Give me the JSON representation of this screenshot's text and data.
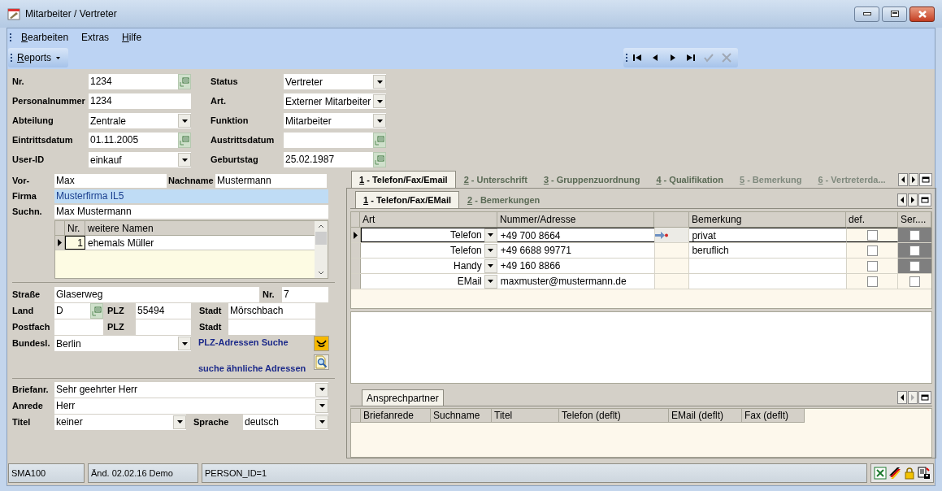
{
  "window": {
    "title": "Mitarbeiter / Vertreter"
  },
  "menu": [
    {
      "label": "Bearbeiten",
      "underline_first": true
    },
    {
      "label": "Extras",
      "underline_first": false
    },
    {
      "label": "Hilfe",
      "underline_first": true
    }
  ],
  "toolbar": {
    "reports": {
      "label": "Reports",
      "underline_first": true
    },
    "nav": [
      {
        "kind": "first",
        "disabled": false
      },
      {
        "kind": "prev",
        "disabled": false
      },
      {
        "kind": "next",
        "disabled": false
      },
      {
        "kind": "last",
        "disabled": false
      },
      {
        "kind": "confirm",
        "disabled": true
      },
      {
        "kind": "cancel",
        "disabled": true
      }
    ]
  },
  "main_form": {
    "left": [
      {
        "label": "Nr.",
        "value": "1234",
        "kind": "lookup"
      },
      {
        "label": "Personalnummer",
        "value": "1234",
        "kind": "text"
      },
      {
        "label": "Abteilung",
        "value": "Zentrale",
        "kind": "dropdown"
      },
      {
        "label": "Eintrittsdatum",
        "value": "01.11.2005",
        "kind": "lookup"
      },
      {
        "label": "User-ID",
        "value": "einkauf",
        "kind": "dropdown"
      }
    ],
    "right": [
      {
        "label": "Status",
        "value": "Vertreter",
        "kind": "dropdown"
      },
      {
        "label": "Art.",
        "value": "Externer Mitarbeiter",
        "kind": "dropdown"
      },
      {
        "label": "Funktion",
        "value": "Mitarbeiter",
        "kind": "dropdown"
      },
      {
        "label": "Austrittsdatum",
        "kind": "lookup"
      },
      {
        "label": "Geburtstag",
        "value": "25.02.1987",
        "kind": "lookup"
      }
    ]
  },
  "name": {
    "first": {
      "label": "Vor-",
      "value": "Max",
      "focused": false
    },
    "last": {
      "label": "Nachname",
      "value": "Mustermann",
      "focused": false
    },
    "company": {
      "label": "Firma",
      "value": "Musterfirma IL5",
      "focused": true
    },
    "search_name": {
      "label": "Suchn.",
      "value": "Max Mustermann",
      "focused": false
    }
  },
  "other_names": {
    "columns": [
      "Nr.",
      "weitere Namen"
    ],
    "rows": [
      {
        "nr": "1",
        "name": "ehemals Müller",
        "current": true
      }
    ]
  },
  "address": {
    "street": {
      "label": "Straße",
      "value": "Glaserweg"
    },
    "house_no": {
      "label": "Nr.",
      "value": "7"
    },
    "country": {
      "label": "Land",
      "value": "D"
    },
    "zip": {
      "label": "PLZ",
      "value": "55494"
    },
    "city": {
      "label": "Stadt",
      "value": "Mörschbach"
    },
    "po_box": {
      "label": "Postfach"
    },
    "po_zip": {
      "label": "PLZ"
    },
    "po_city": {
      "label": "Stadt"
    },
    "state": {
      "label": "Bundesl.",
      "value": "Berlin"
    }
  },
  "links": [
    {
      "label": "PLZ-Adressen Suche",
      "kind": "post"
    },
    {
      "label": "suche ähnliche Adressen",
      "kind": "search"
    }
  ],
  "salutation": {
    "letter": {
      "label": "Briefanr.",
      "value": "Sehr geehrter Herr"
    },
    "address": {
      "label": "Anrede",
      "value": "Herr"
    },
    "title": {
      "label": "Titel",
      "value": "keiner"
    },
    "language": {
      "label": "Sprache",
      "value": "deutsch"
    }
  },
  "tabs": [
    {
      "label": "1 - Telefon/Fax/Email",
      "selected": true,
      "disabled": false
    },
    {
      "label": "2 - Unterschrift",
      "selected": false,
      "disabled": false
    },
    {
      "label": "3 - Gruppenzuordnung",
      "selected": false,
      "disabled": false
    },
    {
      "label": "4 - Qualifikation",
      "selected": false,
      "disabled": false
    },
    {
      "label": "5 - Bemerkung",
      "selected": false,
      "disabled": true
    },
    {
      "label": "6 - Vertreterda...",
      "selected": false,
      "disabled": true
    }
  ],
  "subtabs": [
    {
      "label": "1 - Telefon/Fax/EMail",
      "selected": true
    },
    {
      "label": "2 - Bemerkungen",
      "selected": false
    }
  ],
  "contacts": {
    "columns": [
      "Art",
      "Nummer/Adresse",
      "Bemerkung",
      "def.",
      "Ser...."
    ],
    "rows": [
      {
        "art": "Telefon",
        "number": "+49 700 8664",
        "link_icon": true,
        "remark": "privat",
        "default_checked": false,
        "ser_checked": false,
        "ser_shaded": true,
        "current": true
      },
      {
        "art": "Telefon",
        "number": "+49 6688 99771",
        "link_icon": false,
        "remark": "beruflich",
        "default_checked": false,
        "ser_checked": false,
        "ser_shaded": true,
        "current": false
      },
      {
        "art": "Handy",
        "number": "+49 160 8866",
        "link_icon": false,
        "default_checked": false,
        "ser_checked": false,
        "ser_shaded": true,
        "current": false
      },
      {
        "art": "EMail",
        "number": "maxmuster@mustermann.de",
        "link_icon": false,
        "default_checked": false,
        "ser_checked": false,
        "ser_shaded": false,
        "current": false
      }
    ]
  },
  "partner_tab": {
    "label": "Ansprechpartner",
    "selected": true
  },
  "partners": {
    "columns": [
      "Briefanrede",
      "Suchname",
      "Titel",
      "Telefon (deflt)",
      "EMail (deflt)",
      "Fax (deflt)"
    ]
  },
  "status_bar": {
    "panels": [
      "SMA100",
      "Änd. 02.02.16 Demo",
      "PERSON_ID=1"
    ]
  }
}
